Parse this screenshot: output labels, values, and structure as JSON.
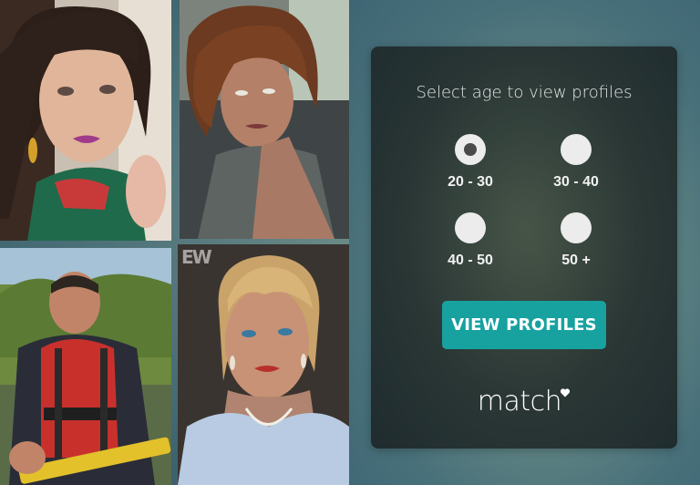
{
  "panel": {
    "heading": "Select age to view profiles",
    "age_options": [
      {
        "label": "20 - 30",
        "selected": true
      },
      {
        "label": "30 - 40",
        "selected": false
      },
      {
        "label": "40 - 50",
        "selected": false
      },
      {
        "label": "50 +",
        "selected": false
      }
    ],
    "button_label": "VIEW PROFILES",
    "logo_text": "match",
    "logo_icon": "heart-icon"
  },
  "photos": {
    "photo_4_watermark": "EW"
  },
  "colors": {
    "button": "#17a2a0",
    "radio": "#ececec",
    "radio_dot": "#4a4a4a",
    "panel": "#2a3634"
  }
}
